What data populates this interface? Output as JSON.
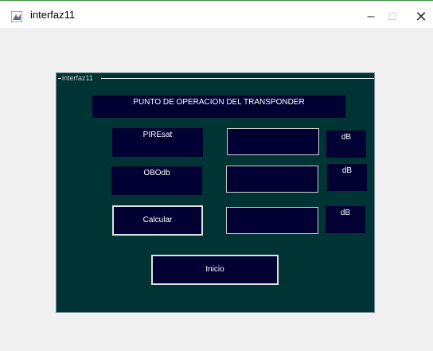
{
  "window": {
    "title": "interfaz11",
    "controls": {
      "minimize": "–",
      "maximize": "☐",
      "close": "✕"
    }
  },
  "panel": {
    "title": "interfaz11",
    "header": "PUNTO DE OPERACION DEL TRANSPONDER",
    "rows": [
      {
        "label": "PIREsat",
        "value": "",
        "unit": "dB"
      },
      {
        "label": "OBOdb",
        "value": "",
        "unit": "dB"
      },
      {
        "label": "Calcular",
        "value": "",
        "unit": "dB"
      }
    ],
    "inicio_button": "Inicio"
  },
  "colors": {
    "panel_bg": "#003333",
    "control_bg": "#000033",
    "window_bg": "#f0f0f0"
  }
}
